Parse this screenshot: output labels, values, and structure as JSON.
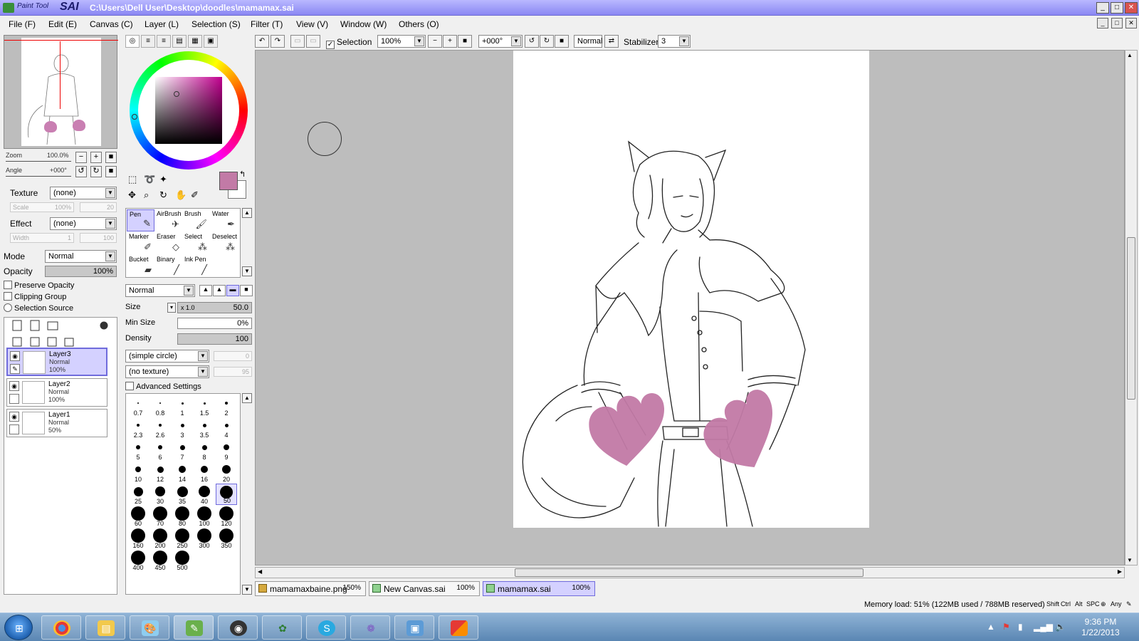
{
  "titlebar": {
    "logo_small": "Paint Tool",
    "logo_big": "SAI",
    "path": "C:\\Users\\Dell User\\Desktop\\doodles\\mamamax.sai",
    "min": "_",
    "max": "□",
    "close": "✕"
  },
  "menu": {
    "items": [
      "File (F)",
      "Edit (E)",
      "Canvas (C)",
      "Layer (L)",
      "Selection (S)",
      "Filter (T)",
      "View (V)",
      "Window (W)",
      "Others (O)"
    ]
  },
  "navigator": {
    "zoom_label": "Zoom",
    "zoom_value": "100.0%",
    "angle_label": "Angle",
    "angle_value": "+000°"
  },
  "layer_props": {
    "texture_label": "Texture",
    "texture_value": "(none)",
    "scale_label": "Scale",
    "scale_value": "100%",
    "scale_num": "20",
    "effect_label": "Effect",
    "effect_value": "(none)",
    "width_label": "Width",
    "width_value": "1",
    "width_num": "100",
    "mode_label": "Mode",
    "mode_value": "Normal",
    "opacity_label": "Opacity",
    "opacity_value": "100%",
    "preserve_opacity": "Preserve Opacity",
    "clipping_group": "Clipping Group",
    "selection_source": "Selection Source"
  },
  "layers": [
    {
      "name": "Layer3",
      "mode": "Normal",
      "opacity": "100%",
      "selected": true
    },
    {
      "name": "Layer2",
      "mode": "Normal",
      "opacity": "100%",
      "selected": false
    },
    {
      "name": "Layer1",
      "mode": "Normal",
      "opacity": "50%",
      "selected": false
    }
  ],
  "tools": {
    "items": [
      "Pen",
      "AirBrush",
      "Brush",
      "Water",
      "Marker",
      "Eraser",
      "Select",
      "Deselect",
      "Bucket",
      "Binary",
      "Ink Pen"
    ],
    "active": "Pen"
  },
  "brush_settings": {
    "blend_mode": "Normal",
    "size_label": "Size",
    "size_mult": "x 1.0",
    "size_value": "50.0",
    "min_size_label": "Min Size",
    "min_size_value": "0%",
    "density_label": "Density",
    "density_value": "100",
    "shape_value": "(simple circle)",
    "shape_num": "0",
    "texture_value": "(no texture)",
    "texture_num": "95",
    "advanced_label": "Advanced Settings"
  },
  "brush_sizes": [
    "0.7",
    "0.8",
    "1",
    "1.5",
    "2",
    "2.3",
    "2.6",
    "3",
    "3.5",
    "4",
    "5",
    "6",
    "7",
    "8",
    "9",
    "10",
    "12",
    "14",
    "16",
    "20",
    "25",
    "30",
    "35",
    "40",
    "50",
    "60",
    "70",
    "80",
    "100",
    "120",
    "160",
    "200",
    "250",
    "300",
    "350",
    "400",
    "450",
    "500"
  ],
  "brush_size_selected": "50",
  "toolbar": {
    "selection_label": "Selection",
    "zoom_value": "100%",
    "angle_value": "+000°",
    "blend_value": "Normal",
    "stabilizer_label": "Stabilizer",
    "stabilizer_value": "3"
  },
  "doc_tabs": [
    {
      "name": "mamamaxbaine.png",
      "zoom": "150%",
      "active": false
    },
    {
      "name": "New Canvas.sai",
      "zoom": "100%",
      "active": false
    },
    {
      "name": "mamamax.sai",
      "zoom": "100%",
      "active": true
    }
  ],
  "status": {
    "memory": "Memory load: 51% (122MB used / 788MB reserved)",
    "keys": [
      "Shift",
      "Ctrl",
      "Alt",
      "SPC",
      "Any"
    ]
  },
  "taskbar": {
    "time": "9:36 PM",
    "date": "1/22/2013",
    "apps": [
      "chrome-icon",
      "explorer-icon",
      "paint-icon",
      "sai-icon",
      "camera-icon",
      "paw-icon",
      "skype-icon",
      "flower-icon",
      "photos-icon",
      "office-icon"
    ]
  },
  "colors": {
    "accent": "#8a87f3",
    "foreground_color": "#c27aa6",
    "heart": "#c27aa6"
  }
}
